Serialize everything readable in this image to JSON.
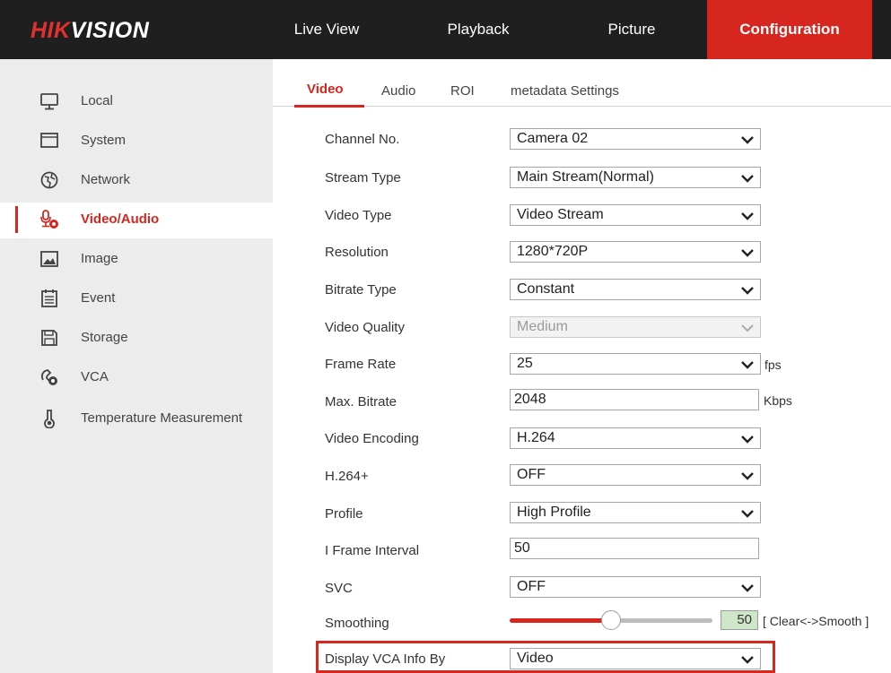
{
  "header": {
    "logo_hik": "HIK",
    "logo_vision": "VISION",
    "nav": [
      "Live View",
      "Playback",
      "Picture",
      "Configuration"
    ],
    "active_nav": "Configuration",
    "accent_color": "#d7261f"
  },
  "sidebar": {
    "items": [
      {
        "label": "Local",
        "icon": "monitor-icon"
      },
      {
        "label": "System",
        "icon": "window-icon"
      },
      {
        "label": "Network",
        "icon": "globe-icon"
      },
      {
        "label": "Video/Audio",
        "icon": "microphone-icon",
        "active": true
      },
      {
        "label": "Image",
        "icon": "image-icon"
      },
      {
        "label": "Event",
        "icon": "calendar-icon"
      },
      {
        "label": "Storage",
        "icon": "floppy-disk-icon"
      },
      {
        "label": "VCA",
        "icon": "vca-icon"
      },
      {
        "label": "Temperature Measurement",
        "icon": "thermometer-icon"
      }
    ]
  },
  "tabs": {
    "items": [
      "Video",
      "Audio",
      "ROI",
      "metadata Settings"
    ],
    "active": "Video"
  },
  "form": {
    "channel_no": {
      "label": "Channel No.",
      "value": "Camera 02"
    },
    "stream_type": {
      "label": "Stream Type",
      "value": "Main Stream(Normal)"
    },
    "video_type": {
      "label": "Video Type",
      "value": "Video Stream"
    },
    "resolution": {
      "label": "Resolution",
      "value": "1280*720P"
    },
    "bitrate_type": {
      "label": "Bitrate Type",
      "value": "Constant"
    },
    "video_quality": {
      "label": "Video Quality",
      "value": "Medium",
      "disabled": true
    },
    "frame_rate": {
      "label": "Frame Rate",
      "value": "25",
      "unit": "fps"
    },
    "max_bitrate": {
      "label": "Max. Bitrate",
      "value": "2048",
      "unit": "Kbps"
    },
    "video_encoding": {
      "label": "Video Encoding",
      "value": "H.264"
    },
    "h264_plus": {
      "label": "H.264+",
      "value": "OFF"
    },
    "profile": {
      "label": "Profile",
      "value": "High Profile"
    },
    "i_frame_interval": {
      "label": "I Frame Interval",
      "value": "50"
    },
    "svc": {
      "label": "SVC",
      "value": "OFF"
    },
    "smoothing": {
      "label": "Smoothing",
      "value": "50",
      "range_hint": "[ Clear<->Smooth ]",
      "level_fraction": 0.5
    },
    "display_vca_info_by": {
      "label": "Display VCA Info By",
      "value": "Video",
      "highlighted": true
    }
  }
}
